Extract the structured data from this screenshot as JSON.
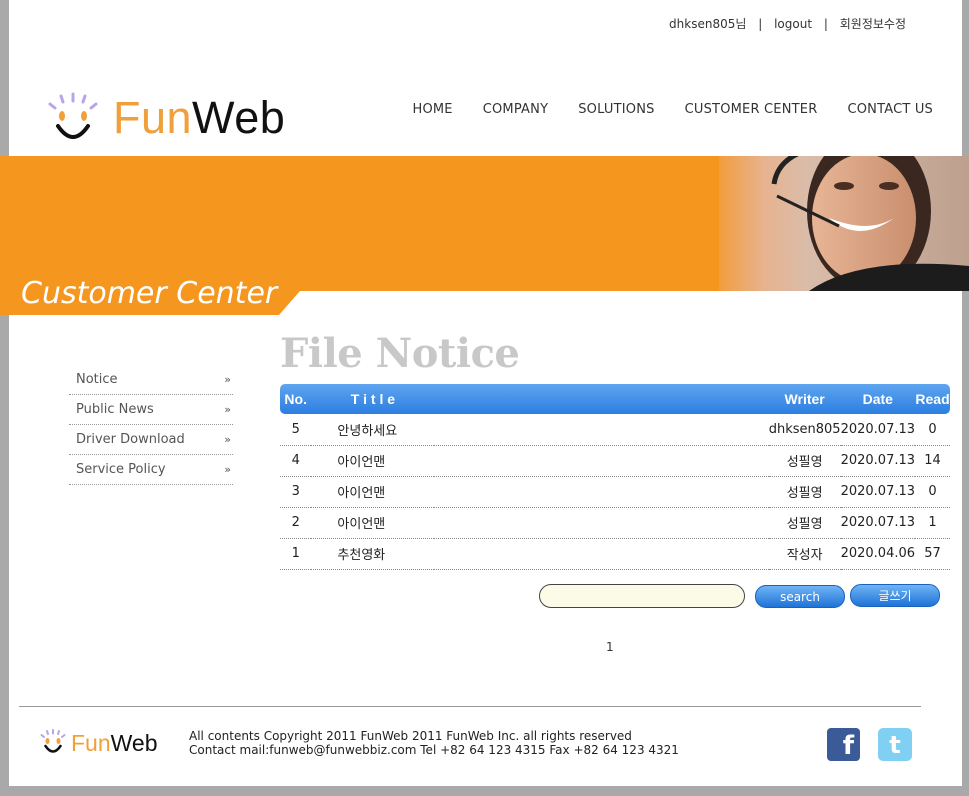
{
  "topbar": {
    "user": "dhksen805님",
    "logout": "logout",
    "edit_profile": "회원정보수정",
    "separator": "|"
  },
  "logo": {
    "fun": "Fun",
    "web": "Web"
  },
  "nav": {
    "items": [
      "HOME",
      "COMPANY",
      "SOLUTIONS",
      "CUSTOMER CENTER",
      "CONTACT US"
    ]
  },
  "banner": {
    "title": "Customer Center",
    "accent": "#f5961e"
  },
  "sidebar": {
    "items": [
      {
        "label": "Notice",
        "chevron": "»"
      },
      {
        "label": "Public News",
        "chevron": "»"
      },
      {
        "label": "Driver Download",
        "chevron": "»"
      },
      {
        "label": "Service Policy",
        "chevron": "»"
      }
    ]
  },
  "content": {
    "title": "File Notice",
    "table": {
      "headers": [
        "No.",
        "T i t l e",
        "Writer",
        "Date",
        "Read"
      ],
      "rows": [
        {
          "no": "5",
          "title": "안녕하세요",
          "writer": "dhksen805",
          "date": "2020.07.13",
          "read": "0"
        },
        {
          "no": "4",
          "title": "아이언맨",
          "writer": "성필영",
          "date": "2020.07.13",
          "read": "14"
        },
        {
          "no": "3",
          "title": "아이언맨",
          "writer": "성필영",
          "date": "2020.07.13",
          "read": "0"
        },
        {
          "no": "2",
          "title": "아이언맨",
          "writer": "성필영",
          "date": "2020.07.13",
          "read": "1"
        },
        {
          "no": "1",
          "title": "추천영화",
          "writer": "작성자",
          "date": "2020.04.06",
          "read": "57"
        }
      ]
    },
    "search": {
      "value": "",
      "button": "search"
    },
    "write_button": "글쓰기",
    "pager": {
      "current": "1"
    }
  },
  "footer": {
    "logo_fun": "Fun",
    "logo_web": "Web",
    "copyright": "All contents Copyright 2011 FunWeb 2011 FunWeb Inc. all rights reserved",
    "contact": "Contact mail:funweb@funwebbiz.com Tel +82 64 123 4315 Fax +82 64 123 4321",
    "facebook": "f",
    "twitter": "t"
  }
}
